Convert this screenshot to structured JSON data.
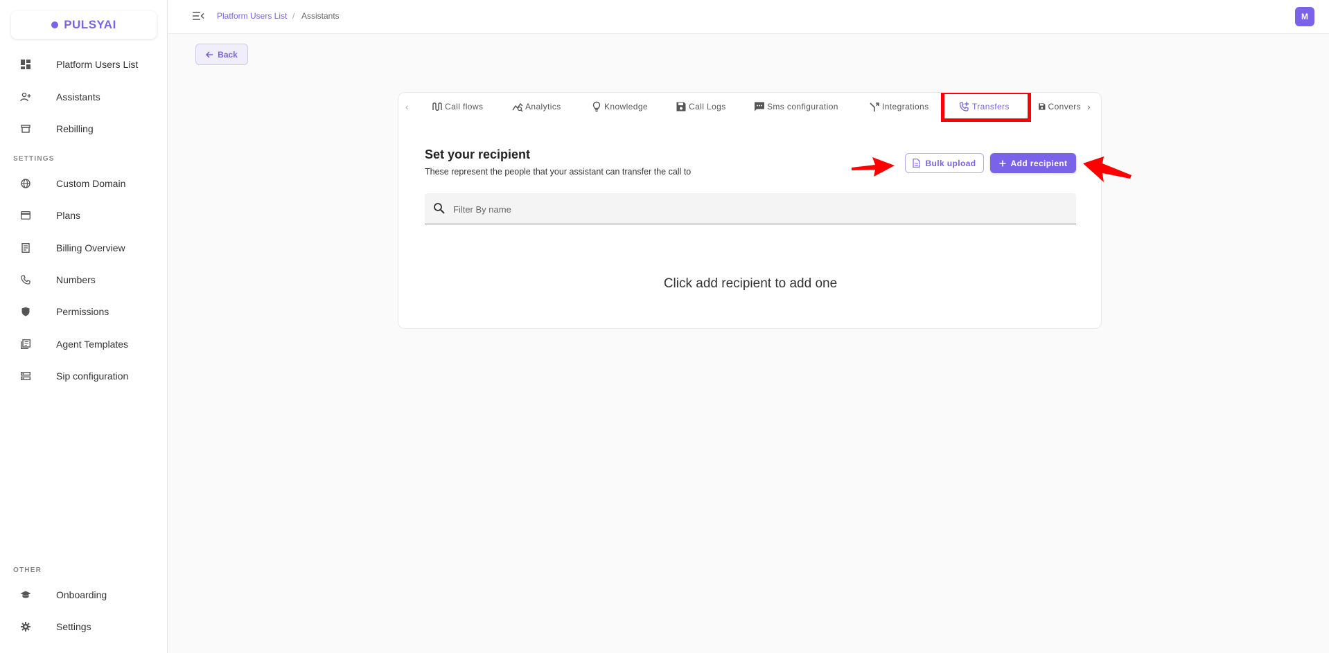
{
  "brand": {
    "name": "PULSYAI",
    "accent": "#7a63e8"
  },
  "sidebar": {
    "items": [
      {
        "label": "Platform Users List",
        "icon": "dashboard-icon"
      },
      {
        "label": "Assistants",
        "icon": "person-add-icon"
      },
      {
        "label": "Rebilling",
        "icon": "store-icon"
      }
    ],
    "settings_label": "SETTINGS",
    "settings_items": [
      {
        "label": "Custom Domain",
        "icon": "globe-icon"
      },
      {
        "label": "Plans",
        "icon": "credit-card-icon"
      },
      {
        "label": "Billing Overview",
        "icon": "receipt-icon"
      },
      {
        "label": "Numbers",
        "icon": "phone-icon"
      },
      {
        "label": "Permissions",
        "icon": "shield-icon"
      },
      {
        "label": "Agent Templates",
        "icon": "library-icon"
      },
      {
        "label": "Sip configuration",
        "icon": "storage-icon"
      }
    ],
    "other_label": "OTHER",
    "other_items": [
      {
        "label": "Onboarding",
        "icon": "graduation-cap-icon"
      },
      {
        "label": "Settings",
        "icon": "gear-icon"
      }
    ]
  },
  "header": {
    "breadcrumb_link": "Platform Users List",
    "breadcrumb_sep": "/",
    "breadcrumb_current": "Assistants",
    "avatar_initial": "M"
  },
  "back_label": "Back",
  "tabs": [
    {
      "label": "Call flows",
      "icon": "flow-icon"
    },
    {
      "label": "Analytics",
      "icon": "analytics-icon"
    },
    {
      "label": "Knowledge",
      "icon": "lightbulb-icon"
    },
    {
      "label": "Call Logs",
      "icon": "save-icon"
    },
    {
      "label": "Sms configuration",
      "icon": "sms-icon"
    },
    {
      "label": "Integrations",
      "icon": "merge-icon"
    },
    {
      "label": "Transfers",
      "icon": "phone-forward-icon",
      "active": true
    },
    {
      "label": "Convers",
      "icon": "save-icon"
    }
  ],
  "recipient": {
    "title": "Set your recipient",
    "subtitle": "These represent the people that your assistant can transfer the call to",
    "bulk_upload_label": "Bulk upload",
    "add_recipient_label": "Add recipient",
    "search_placeholder": "Filter By name",
    "empty_message": "Click add recipient to add one"
  },
  "annotation_color": "#ff0000"
}
